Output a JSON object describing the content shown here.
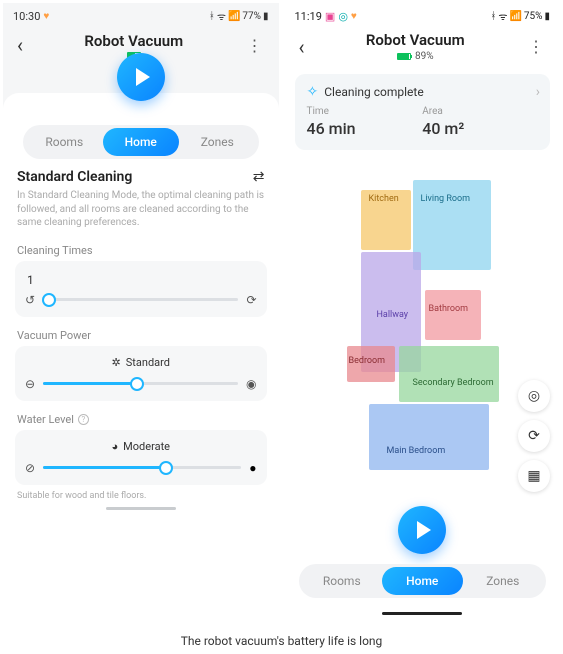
{
  "left": {
    "status": {
      "time": "10:30",
      "battery": "77%",
      "signal": "⁴ᴳ"
    },
    "title": "Robot Vacuum",
    "tabs": {
      "rooms": "Rooms",
      "home": "Home",
      "zones": "Zones"
    },
    "mode": {
      "title": "Standard Cleaning",
      "desc": "In Standard Cleaning Mode, the optimal cleaning path is followed, and all rooms are cleaned according to the same cleaning preferences."
    },
    "times": {
      "label": "Cleaning Times",
      "value": "1"
    },
    "power": {
      "label": "Vacuum Power",
      "setting": "Standard"
    },
    "water": {
      "label": "Water Level",
      "setting": "Moderate"
    },
    "hint": "Suitable for wood and tile floors."
  },
  "right": {
    "status": {
      "time": "11:19",
      "battery": "75%"
    },
    "title": "Robot Vacuum",
    "batt": "89%",
    "state": "Cleaning complete",
    "metrics": {
      "time_label": "Time",
      "time_val": "46 min",
      "area_label": "Area",
      "area_val": "40 m²"
    },
    "rooms": {
      "kitchen": "Kitchen",
      "living": "Living Room",
      "hallway": "Hallway",
      "bath": "Bathroom",
      "bed": "Bedroom",
      "secbed": "Secondary Bedroom",
      "mainbed": "Main Bedroom"
    },
    "tabs": {
      "rooms": "Rooms",
      "home": "Home",
      "zones": "Zones"
    }
  },
  "caption": "The robot vacuum's battery life is long"
}
